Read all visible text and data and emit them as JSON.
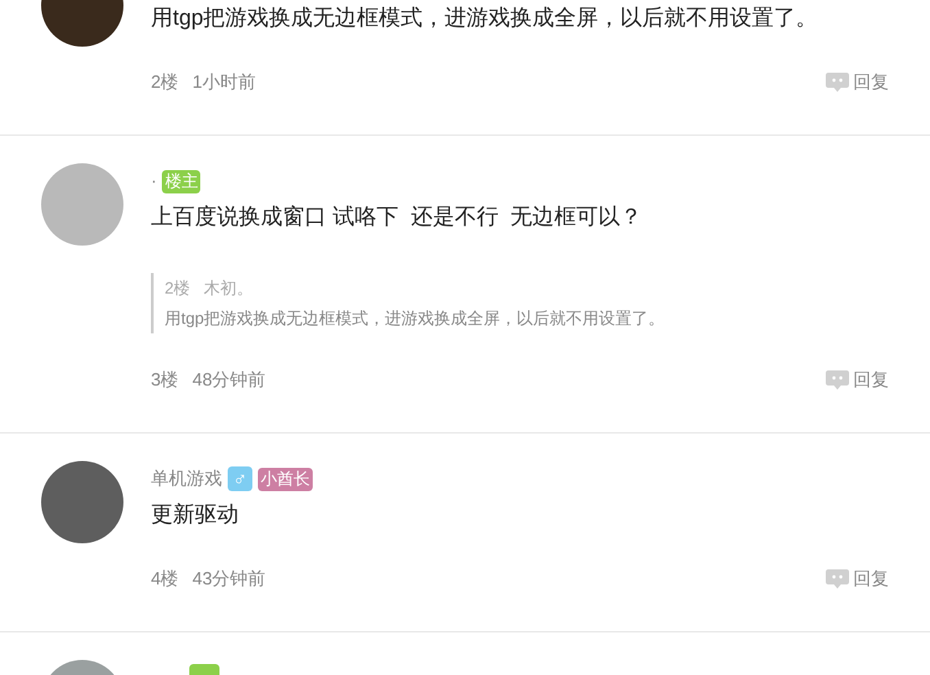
{
  "posts": [
    {
      "text": "用tgp把游戏换成无边框模式，进游戏换成全屏，以后就不用设置了。",
      "floor": "2楼",
      "time": "1小时前",
      "reply": "回复"
    },
    {
      "author": "·",
      "badges": [
        {
          "kind": "owner",
          "label": "楼主",
          "color": "#8cd04a"
        }
      ],
      "text": "上百度说换成窗口 试咯下  还是不行  无边框可以？",
      "quote": {
        "floor": "2楼",
        "author": "木初。",
        "text": "用tgp把游戏换成无边框模式，进游戏换成全屏，以后就不用设置了。"
      },
      "floor": "3楼",
      "time": "48分钟前",
      "reply": "回复"
    },
    {
      "author": "单机游戏",
      "badges": [
        {
          "kind": "gender",
          "label": "♂",
          "color": "#7ecdf2"
        },
        {
          "kind": "title",
          "label": "小酋长",
          "color": "#cd7fa3"
        }
      ],
      "text": "更新驱动",
      "floor": "4楼",
      "time": "43分钟前",
      "reply": "回复"
    },
    {
      "cut": true
    }
  ]
}
